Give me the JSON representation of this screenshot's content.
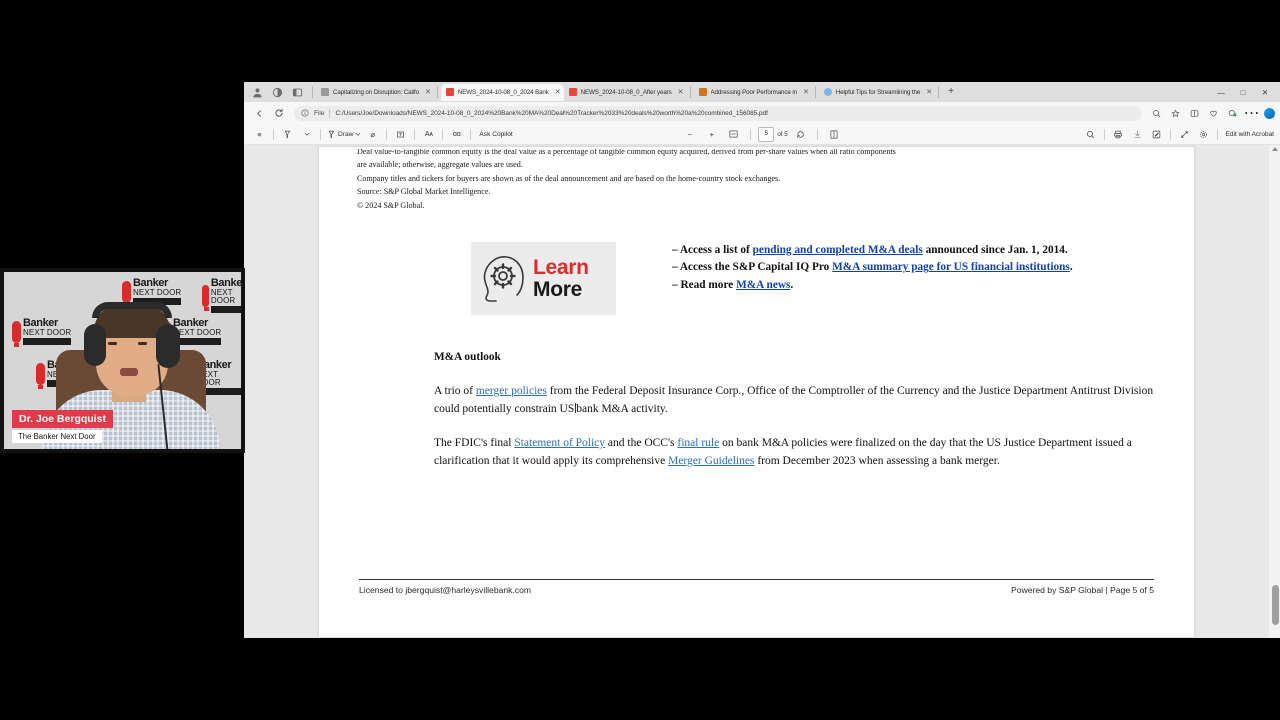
{
  "browser": {
    "tabs": [
      {
        "label": "Capitalizing on Disruption: Califo",
        "favicon": "#9a9a9a",
        "active": false
      },
      {
        "label": "NEWS_2024-10-08_0_2024 Bank",
        "favicon": "#e8453c",
        "active": true
      },
      {
        "label": "NEWS_2024-10-08_0_After years",
        "favicon": "#e8453c",
        "active": false
      },
      {
        "label": "Addressing Poor Performance in",
        "favicon": "#c9761f",
        "active": false
      },
      {
        "label": "Helpful Tips for Streamlining the",
        "favicon": "#7fb4e8",
        "active": false
      }
    ],
    "new_tab_label": "+",
    "window_controls": {
      "minimize": "—",
      "maximize": "□",
      "close": "✕"
    },
    "address": {
      "scheme_label": "File",
      "url": "C:/Users/Joe/Downloads/NEWS_2024-10-08_0_2024%20Bank%20MA%20Deal%20Tracker%2033%20deals%20worth%20a%20combined_156085.pdf"
    },
    "nav_icons": {
      "back": "←",
      "forward": "→",
      "reload": "↻",
      "info": "ⓘ",
      "zoom": "⊕",
      "favorite": "☆",
      "split": "◫",
      "collections": "⊕",
      "copilot": "◑",
      "extensions": "⧉",
      "more": "⋯"
    }
  },
  "pdf_toolbar": {
    "contents_icon": "≡",
    "highlight_icon": "✐",
    "draw_label": "Draw",
    "erase_icon": "⌀",
    "text_icon": "▣",
    "read_aloud_icon": "Aᴀ",
    "translate_icon": "ɑɑ",
    "ask_copilot_label": "Ask Copilot",
    "zoom_out": "−",
    "zoom_in": "+",
    "fit_page_icon": "❐",
    "page_number": "5",
    "page_total": "of 5",
    "rotate_icon": "↺",
    "page_view_icon": "◫",
    "search_icon": "⌕",
    "print_icon": "⎙",
    "save_icon": "⤓",
    "annotate_icon": "✎",
    "fullscreen_icon": "⤢",
    "settings_icon": "⚙",
    "edit_with_acrobat_label": "Edit with Acrobat"
  },
  "document": {
    "top_note": {
      "clipped_line": "Deal value-to-tangible common equity is the deal value as a percentage of tangible common equity acquired, derived from per-share values when all ratio components",
      "line2": "are available; otherwise, aggregate values are used.",
      "line3": "Company titles and tickers for buyers are shown as of the deal announcement and are based on the home-country stock exchanges.",
      "line4": "Source: S&P Global Market Intelligence.",
      "line5": "© 2024 S&P Global."
    },
    "learn_more": {
      "line1": "Learn",
      "line2": "More",
      "icon": "brain-gear-icon"
    },
    "bullets": [
      {
        "prefix": "– Access a list of ",
        "link": "pending and completed M&A deals",
        "suffix": " announced since Jan. 1, 2014."
      },
      {
        "prefix": "– Access the S&P Capital IQ Pro ",
        "link": "M&A summary page for US financial institutions",
        "suffix": "."
      },
      {
        "prefix": "– Read more ",
        "link": "M&A news",
        "suffix": "."
      }
    ],
    "outlook_heading": "M&A outlook",
    "paragraph1": {
      "a": "A trio of ",
      "link1": "merger policies",
      "b": " from the Federal Deposit Insurance Corp., Office of the Comptroller of the Currency and the Justice Department Antitrust Division could potentially constrain US",
      "c": "bank M&A activity."
    },
    "paragraph2": {
      "a": "The FDIC's final ",
      "link1": "Statement of Policy",
      "b": " and the OCC's ",
      "link2": "final rule",
      "c": " on bank M&A policies were finalized on the day that the US Justice Department issued a clarification that it would apply its comprehensive ",
      "link3": "Merger Guidelines",
      "d": " from December 2023 when assessing a bank merger."
    },
    "footer_left": "Licensed to jbergquist@harleysvillebank.com",
    "footer_right": "Powered by S&P Global | Page 5 of 5"
  },
  "webcam": {
    "name": "Dr. Joe Bergquist",
    "subtitle": "The Banker Next Door",
    "backdrop_brand": {
      "line1": "Banker",
      "line2": "NEXT DOOR"
    },
    "accent_color": "#e03b4a"
  }
}
